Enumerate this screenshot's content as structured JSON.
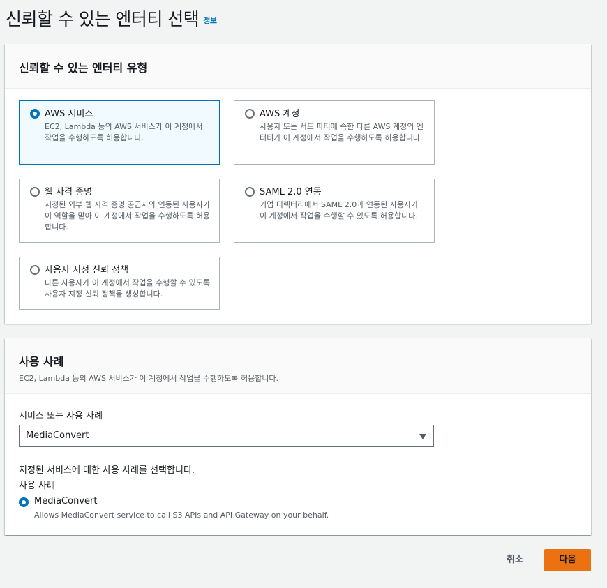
{
  "page": {
    "title": "신뢰할 수 있는 엔터티 선택",
    "info_link": "정보"
  },
  "entity_type": {
    "title": "신뢰할 수 있는 엔터티 유형",
    "options": [
      {
        "label": "AWS 서비스",
        "desc": "EC2, Lambda 등의 AWS 서비스가 이 계정에서 작업을 수행하도록 허용합니다.",
        "selected": true
      },
      {
        "label": "AWS 계정",
        "desc": "사용자 또는 서드 파티에 속한 다른 AWS 계정의 엔터티가 이 계정에서 작업을 수행하도록 허용합니다.",
        "selected": false
      },
      {
        "label": "웹 자격 증명",
        "desc": "지정된 외부 웹 자격 증명 공급자와 연동된 사용자가 이 역할을 맡아 이 계정에서 작업을 수행하도록 허용합니다.",
        "selected": false
      },
      {
        "label": "SAML 2.0 연동",
        "desc": "기업 디렉터리에서 SAML 2.0과 연동된 사용자가 이 계정에서 작업을 수행할 수 있도록 허용합니다.",
        "selected": false
      },
      {
        "label": "사용자 지정 신뢰 정책",
        "desc": "다른 사용자가 이 계정에서 작업을 수행할 수 있도록 사용자 지정 신뢰 정책을 생성합니다.",
        "selected": false
      }
    ]
  },
  "use_case": {
    "title": "사용 사례",
    "desc": "EC2, Lambda 등의 AWS 서비스가 이 계정에서 작업을 수행하도록 허용합니다.",
    "service_label": "서비스 또는 사용 사례",
    "service_value": "MediaConvert",
    "hint": "지정된 서비스에 대한 사용 사례를 선택합니다.",
    "use_case_label": "사용 사례",
    "option_label": "MediaConvert",
    "option_desc": "Allows MediaConvert service to call S3 APIs and API Gateway on your behalf."
  },
  "footer": {
    "cancel": "취소",
    "next": "다음"
  },
  "colors": {
    "accent": "#0073bb",
    "primary_button": "#ec7211",
    "selected_tile_bg": "#f1faff"
  }
}
